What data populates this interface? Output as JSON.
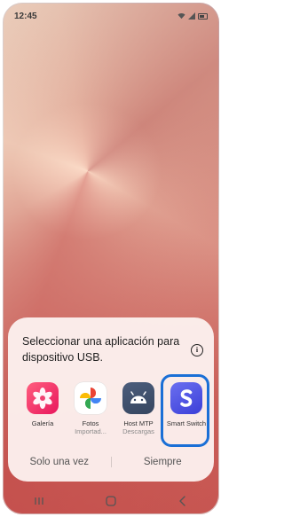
{
  "status_bar": {
    "time": "12:45"
  },
  "dialog": {
    "title": "Seleccionar una aplicación para dispositivo USB.",
    "info_icon": "info-icon",
    "apps": [
      {
        "label": "Galería",
        "sub": "",
        "icon": "galeria-icon"
      },
      {
        "label": "Fotos",
        "sub": "Importad...",
        "icon": "google-photos-icon"
      },
      {
        "label": "Host MTP",
        "sub": "Descargas",
        "icon": "android-icon"
      },
      {
        "label": "Smart Switch",
        "sub": "",
        "icon": "smart-switch-icon",
        "highlight_color": "#1a6fd6"
      }
    ],
    "actions": {
      "once": "Solo una vez",
      "always": "Siempre"
    }
  },
  "navbar": {
    "icons": [
      "recents-icon",
      "home-icon",
      "back-icon"
    ]
  }
}
